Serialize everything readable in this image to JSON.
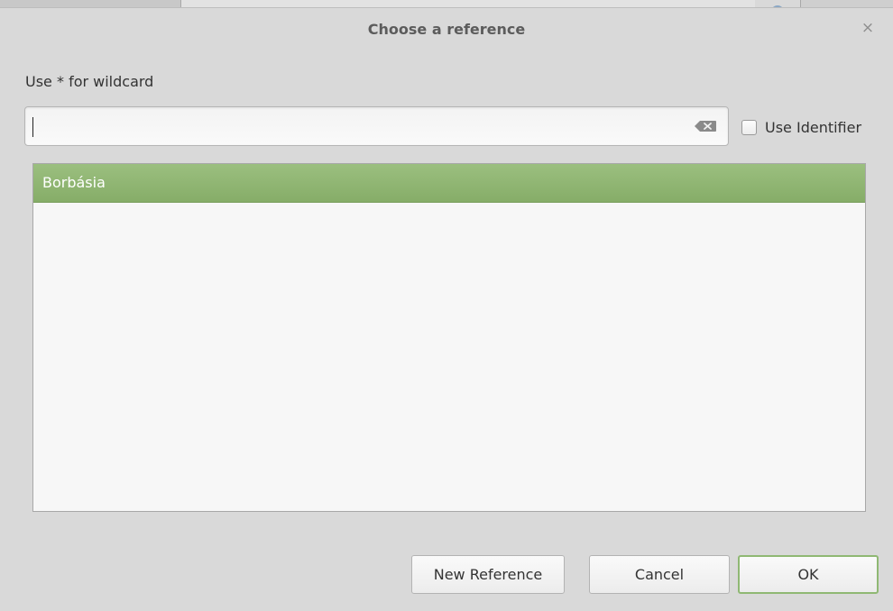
{
  "dialog": {
    "title": "Choose a reference",
    "close_glyph": "×",
    "close_icon": "close-icon"
  },
  "search": {
    "hint": "Use * for wildcard",
    "value": "",
    "placeholder": "",
    "clear_icon": "backspace-clear-icon"
  },
  "use_identifier": {
    "label": "Use Identifier",
    "checked": false
  },
  "references": {
    "items": [
      {
        "label": "Borbásia",
        "selected": true
      }
    ]
  },
  "buttons": {
    "new_reference": "New Reference",
    "cancel": "Cancel",
    "ok": "OK"
  },
  "colors": {
    "selection": "#8fb873",
    "ok_border": "#8fb873",
    "dialog_bg": "#d9d9d9"
  }
}
